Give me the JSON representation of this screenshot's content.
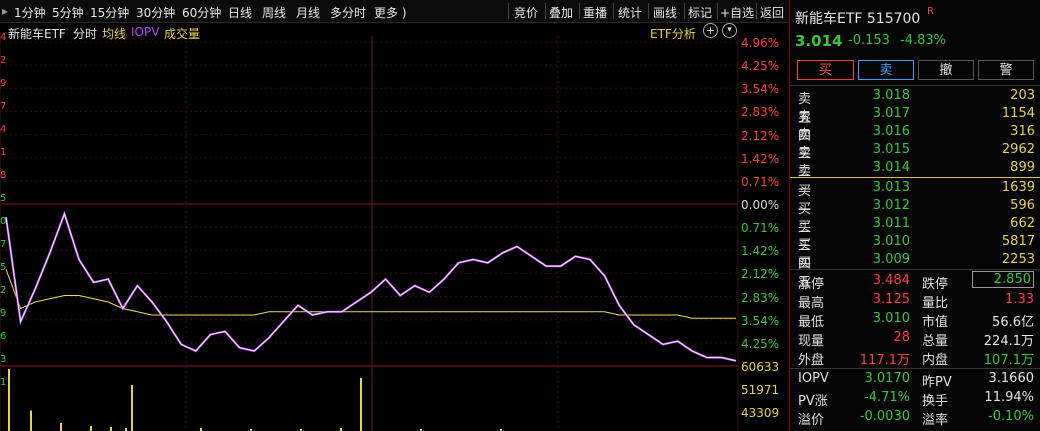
{
  "menu": {
    "periods": [
      "1分钟",
      "5分钟",
      "15分钟",
      "30分钟",
      "60分钟",
      "日线",
      "周线",
      "月线",
      "多分时",
      "更多 )"
    ],
    "tools": [
      "竞价",
      "叠加",
      "重播",
      "统计",
      "画线",
      "标记",
      "+自选",
      "返回"
    ]
  },
  "chart_header": {
    "name": "新能车ETF",
    "mode": "分时",
    "avg": "均线",
    "iopv": "IOPV",
    "volume": "成交量",
    "etf_analysis": "ETF分析",
    "add_icon": "plus-circle-icon",
    "more_icon": "chevron-down-icon"
  },
  "axis": {
    "pct_labels": [
      "4.96%",
      "4.25%",
      "3.54%",
      "2.83%",
      "2.12%",
      "1.42%",
      "0.71%",
      "0.00%",
      "0.71%",
      "1.42%",
      "2.12%",
      "2.83%",
      "3.54%",
      "4.25%"
    ],
    "vol_labels": [
      "60633",
      "51971",
      "43309"
    ],
    "left_digits": [
      "4",
      "2",
      "9",
      "7",
      "4",
      "1",
      "8",
      "5",
      "0",
      "7",
      "5",
      "2",
      "9",
      "6",
      "3",
      "1"
    ]
  },
  "chart_data": {
    "type": "line",
    "prev_close": 3.167,
    "ylim_pct": [
      -4.96,
      4.96
    ],
    "series": [
      {
        "name": "IOPV",
        "color": "#c040ff",
        "values_pct": [
          -0.4,
          -3.6,
          -2.6,
          -1.5,
          -0.3,
          -1.7,
          -2.4,
          -2.3,
          -3.2,
          -2.5,
          -3.0,
          -3.6,
          -4.3,
          -4.5,
          -4.0,
          -3.9,
          -4.4,
          -4.5,
          -4.1,
          -3.6,
          -3.1,
          -3.4,
          -3.3,
          -3.3,
          -3.0,
          -2.7,
          -2.3,
          -2.8,
          -2.5,
          -2.7,
          -2.3,
          -1.8,
          -1.7,
          -1.8,
          -1.5,
          -1.3,
          -1.6,
          -1.9,
          -1.9,
          -1.6,
          -1.7,
          -2.2,
          -3.1,
          -3.7,
          -4.0,
          -4.3,
          -4.2,
          -4.5,
          -4.7,
          -4.7,
          -4.8
        ]
      },
      {
        "name": "price",
        "color": "#f0f0f0",
        "values_pct": [
          -0.4,
          -3.6,
          -2.6,
          -1.5,
          -0.3,
          -1.7,
          -2.4,
          -2.3,
          -3.2,
          -2.5,
          -3.0,
          -3.6,
          -4.3,
          -4.5,
          -4.0,
          -3.9,
          -4.4,
          -4.5,
          -4.1,
          -3.6,
          -3.1,
          -3.4,
          -3.3,
          -3.3,
          -3.0,
          -2.7,
          -2.3,
          -2.8,
          -2.5,
          -2.7,
          -2.3,
          -1.8,
          -1.7,
          -1.8,
          -1.5,
          -1.3,
          -1.6,
          -1.9,
          -1.9,
          -1.6,
          -1.7,
          -2.2,
          -3.1,
          -3.7,
          -4.0,
          -4.3,
          -4.2,
          -4.5,
          -4.7,
          -4.7,
          -4.8
        ]
      },
      {
        "name": "均线",
        "color": "#e8e05a",
        "values_pct": [
          -2.0,
          -3.2,
          -3.0,
          -2.9,
          -2.8,
          -2.8,
          -2.9,
          -3.0,
          -3.2,
          -3.3,
          -3.4,
          -3.4,
          -3.4,
          -3.4,
          -3.4,
          -3.4,
          -3.4,
          -3.4,
          -3.3,
          -3.3,
          -3.3,
          -3.3,
          -3.3,
          -3.3,
          -3.3,
          -3.3,
          -3.3,
          -3.3,
          -3.3,
          -3.3,
          -3.3,
          -3.3,
          -3.3,
          -3.3,
          -3.3,
          -3.3,
          -3.3,
          -3.3,
          -3.3,
          -3.3,
          -3.3,
          -3.3,
          -3.4,
          -3.4,
          -3.4,
          -3.4,
          -3.4,
          -3.5,
          -3.5,
          -3.5,
          -3.5
        ]
      }
    ],
    "volume_bars": [
      60633,
      20000,
      8000,
      5000,
      4000,
      3000,
      45000,
      3000,
      2000,
      2000,
      3000,
      52000,
      2000,
      2000
    ]
  },
  "panel": {
    "title": "新能车ETF 515700",
    "badge": "R",
    "price": "3.014",
    "change": "-0.153",
    "change_pct": "-4.83%",
    "buttons": [
      "买",
      "卖",
      "撤",
      "警"
    ],
    "asks": [
      {
        "label": "卖五",
        "price": "3.018",
        "vol": "203"
      },
      {
        "label": "卖四",
        "price": "3.017",
        "vol": "1154"
      },
      {
        "label": "卖三",
        "price": "3.016",
        "vol": "316"
      },
      {
        "label": "卖二",
        "price": "3.015",
        "vol": "2962"
      },
      {
        "label": "卖一",
        "price": "3.014",
        "vol": "899"
      }
    ],
    "bids": [
      {
        "label": "买一",
        "price": "3.013",
        "vol": "1639"
      },
      {
        "label": "买二",
        "price": "3.012",
        "vol": "596"
      },
      {
        "label": "买三",
        "price": "3.011",
        "vol": "662"
      },
      {
        "label": "买四",
        "price": "3.010",
        "vol": "5817"
      },
      {
        "label": "买五",
        "price": "3.009",
        "vol": "2253"
      }
    ],
    "stats": {
      "limit_up_label": "涨停",
      "limit_up": "3.484",
      "limit_down_label": "跌停",
      "limit_down": "2.850",
      "high_label": "最高",
      "high": "3.125",
      "vol_ratio_label": "量比",
      "vol_ratio": "1.33",
      "low_label": "最低",
      "low": "3.010",
      "mktcap_label": "市值",
      "mktcap": "56.6亿",
      "cur_label": "现量",
      "cur": "28",
      "total_label": "总量",
      "total": "224.1万",
      "outer_label": "外盘",
      "outer": "117.1万",
      "inner_label": "内盘",
      "inner": "107.1万",
      "iopv_label": "IOPV",
      "iopv": "3.0170",
      "prev_pv_label": "昨PV",
      "prev_pv": "3.1660",
      "pv_chg_label": "PV涨",
      "pv_chg": "-4.71%",
      "turnover_label": "换手",
      "turnover": "11.94%",
      "premium_label": "溢价",
      "premium": "-0.0030",
      "premium_rate_label": "溢率",
      "premium_rate": "-0.10%"
    }
  }
}
